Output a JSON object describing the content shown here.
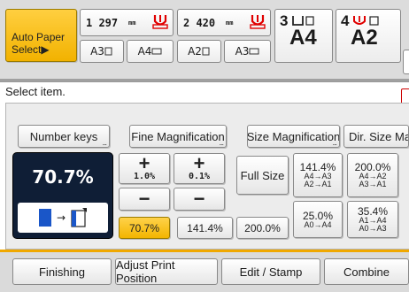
{
  "paper": {
    "auto_select_label_line1": "Auto Paper",
    "auto_select_label_line2": "Select▶",
    "tray1": {
      "length": "1 297",
      "unit": "mm",
      "sizes": [
        "A3",
        "A4"
      ]
    },
    "tray2": {
      "length": "2 420",
      "unit": "mm",
      "sizes": [
        "A2",
        "A3"
      ]
    },
    "tray3": {
      "number": "3",
      "size": "A4"
    },
    "tray4": {
      "number": "4",
      "size": "A2"
    }
  },
  "message": "Select item.",
  "tabs_top": {
    "number_keys": "Number keys",
    "fine_magnification": "Fine Magnification",
    "size_magnification": "Size Magnification",
    "dir_size_mag": "Dir. Size Mag."
  },
  "ratio": {
    "value": "70.7%",
    "increment_fine": "1.0%",
    "increment_coarse": "0.1%",
    "plus": "+",
    "minus": "−"
  },
  "presets": {
    "full_size": "Full Size",
    "p1": {
      "pct": "141.4%",
      "sub1": "A4→A3",
      "sub2": "A2→A1"
    },
    "p2": {
      "pct": "200.0%",
      "sub1": "A4→A2",
      "sub2": "A3→A1"
    },
    "p3": {
      "pct": "25.0%",
      "sub1": "A0→A4",
      "sub2": ""
    },
    "p4": {
      "pct": "35.4%",
      "sub1": "A1→A4",
      "sub2": "A0→A3"
    },
    "quick": [
      "70.7%",
      "141.4%",
      "200.0%"
    ]
  },
  "bottom_tabs": [
    "Finishing",
    "Adjust Print Position",
    "Edit / Stamp",
    "Combine"
  ],
  "colors": {
    "accent_yellow": "#f3b500",
    "ratio_bg": "#0f1e36",
    "arrow_blue": "#1a56c8"
  }
}
